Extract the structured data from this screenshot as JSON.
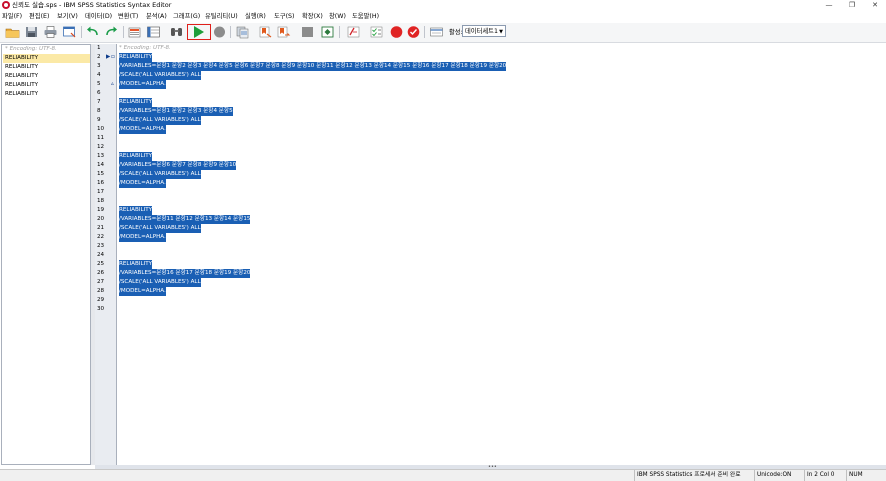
{
  "window": {
    "title": "신뢰도 실습.sps - IBM SPSS Statistics Syntax Editor",
    "minimize_glyph": "—",
    "restore_glyph": "❐",
    "close_glyph": "✕"
  },
  "menu": [
    {
      "label": "파일(F)"
    },
    {
      "label": "편집(E)"
    },
    {
      "label": "보기(V)"
    },
    {
      "label": "데이터(D)"
    },
    {
      "label": "변환(T)"
    },
    {
      "label": "분석(A)"
    },
    {
      "label": "그래프(G)"
    },
    {
      "label": "유틸리티(U)"
    },
    {
      "label": "실행(R)"
    },
    {
      "label": "도구(S)"
    },
    {
      "label": "확장(X)"
    },
    {
      "label": "창(W)"
    },
    {
      "label": "도움말(H)"
    }
  ],
  "toolbar": {
    "active_label": "활성:",
    "dataset_value": "데이터세트1",
    "colors": {
      "run": "#1e9e3a",
      "highlight_border": "#e0201b",
      "stop": "#e02424"
    },
    "icons": [
      "open-folder-icon",
      "save-icon",
      "print-icon",
      "dialog-recall-icon",
      "undo-icon",
      "redo-icon",
      "goto-case-icon",
      "variables-icon",
      "find-icon",
      "run-selection-icon",
      "stop-icon",
      "export-icon",
      "bookmark-icon",
      "next-bookmark-icon",
      "toggle-comment-icon",
      "validate-icon",
      "syntax-help-icon",
      "breakpoint-icon",
      "check-icon",
      "show-lines-icon"
    ]
  },
  "navigator": {
    "items": [
      {
        "label": "* Encoding: UTF-8.",
        "kind": "encoding"
      },
      {
        "label": "RELIABILITY",
        "kind": "selected"
      },
      {
        "label": "RELIABILITY",
        "kind": "normal"
      },
      {
        "label": "RELIABILITY",
        "kind": "normal"
      },
      {
        "label": "RELIABILITY",
        "kind": "normal"
      },
      {
        "label": "RELIABILITY",
        "kind": "normal"
      }
    ]
  },
  "editor": {
    "line_numbers": [
      "1",
      "2",
      "3",
      "4",
      "5",
      "6",
      "7",
      "8",
      "9",
      "10",
      "11",
      "12",
      "13",
      "14",
      "15",
      "16",
      "17",
      "18",
      "19",
      "20",
      "21",
      "22",
      "23",
      "24",
      "25",
      "26",
      "27",
      "28",
      "29",
      "30"
    ],
    "lines": [
      {
        "text": "* Encoding: UTF-8.",
        "kind": "encoding"
      },
      {
        "text": "RELIABILITY",
        "kind": "sel"
      },
      {
        "text": "  /VARIABLES=문항1 문항2 문항3 문항4 문항5 문항6 문항7 문항8 문항9 문항10 문항11 문항12 문항13 문항14 문항15 문항16 문항17 문항18 문항19 문항20",
        "kind": "sel"
      },
      {
        "text": "  /SCALE('ALL VARIABLES') ALL",
        "kind": "sel"
      },
      {
        "text": "  /MODEL=ALPHA.",
        "kind": "sel"
      },
      {
        "text": "",
        "kind": "blank"
      },
      {
        "text": "RELIABILITY",
        "kind": "sel"
      },
      {
        "text": "  /VARIABLES=문항1 문항2 문항3 문항4 문항5",
        "kind": "sel"
      },
      {
        "text": "  /SCALE('ALL VARIABLES') ALL",
        "kind": "sel"
      },
      {
        "text": "  /MODEL=ALPHA.",
        "kind": "sel"
      },
      {
        "text": "",
        "kind": "blank"
      },
      {
        "text": "",
        "kind": "blank"
      },
      {
        "text": "RELIABILITY",
        "kind": "sel"
      },
      {
        "text": "  /VARIABLES=문항6 문항7 문항8 문항9 문항10",
        "kind": "sel"
      },
      {
        "text": "  /SCALE('ALL VARIABLES') ALL",
        "kind": "sel"
      },
      {
        "text": "  /MODEL=ALPHA.",
        "kind": "sel"
      },
      {
        "text": "",
        "kind": "blank"
      },
      {
        "text": "",
        "kind": "blank"
      },
      {
        "text": "RELIABILITY",
        "kind": "sel"
      },
      {
        "text": "  /VARIABLES=문항11 문항12 문항13 문항14 문항15",
        "kind": "sel"
      },
      {
        "text": "  /SCALE('ALL VARIABLES') ALL",
        "kind": "sel"
      },
      {
        "text": "  /MODEL=ALPHA.",
        "kind": "sel"
      },
      {
        "text": "",
        "kind": "blank"
      },
      {
        "text": "",
        "kind": "blank"
      },
      {
        "text": "RELIABILITY",
        "kind": "sel"
      },
      {
        "text": "  /VARIABLES=문항16 문항17 문항18 문항19 문항20",
        "kind": "sel"
      },
      {
        "text": "  /SCALE('ALL VARIABLES') ALL",
        "kind": "sel"
      },
      {
        "text": "  /MODEL=ALPHA.",
        "kind": "sel"
      },
      {
        "text": "",
        "kind": "blank"
      },
      {
        "text": "",
        "kind": "blank"
      }
    ]
  },
  "status": {
    "processor": "IBM SPSS Statistics 프로세서 준비 완료",
    "unicode": "Unicode:ON",
    "position": "In 2 Col 0",
    "num": "NUM"
  }
}
